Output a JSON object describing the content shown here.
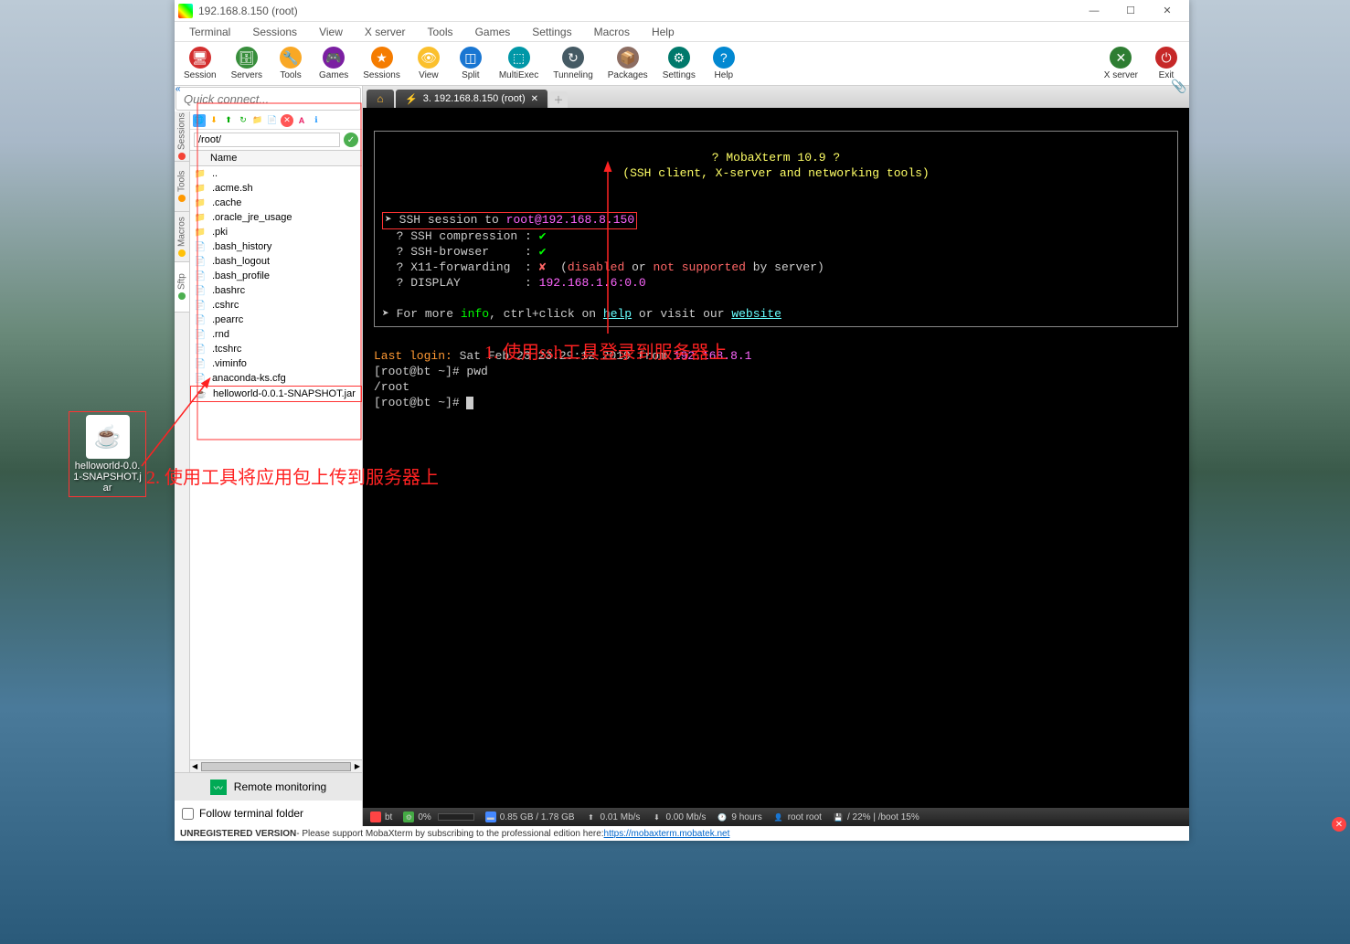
{
  "titlebar": {
    "text": "192.168.8.150 (root)"
  },
  "window_controls": {
    "min": "—",
    "max": "☐",
    "close": "✕"
  },
  "menubar": [
    "Terminal",
    "Sessions",
    "View",
    "X server",
    "Tools",
    "Games",
    "Settings",
    "Macros",
    "Help"
  ],
  "toolbar": [
    {
      "label": "Session",
      "bg": "#d32f2f",
      "glyph": "🖥"
    },
    {
      "label": "Servers",
      "bg": "#388e3c",
      "glyph": "🗄"
    },
    {
      "label": "Tools",
      "bg": "#f9a825",
      "glyph": "🔧"
    },
    {
      "label": "Games",
      "bg": "#7b1fa2",
      "glyph": "🎮"
    },
    {
      "label": "Sessions",
      "bg": "#f57c00",
      "glyph": "★"
    },
    {
      "label": "View",
      "bg": "#fbc02d",
      "glyph": "👁"
    },
    {
      "label": "Split",
      "bg": "#1976d2",
      "glyph": "◫"
    },
    {
      "label": "MultiExec",
      "bg": "#0097a7",
      "glyph": "⬚"
    },
    {
      "label": "Tunneling",
      "bg": "#455a64",
      "glyph": "↻"
    },
    {
      "label": "Packages",
      "bg": "#8d6e63",
      "glyph": "📦"
    },
    {
      "label": "Settings",
      "bg": "#00796b",
      "glyph": "⚙"
    },
    {
      "label": "Help",
      "bg": "#0288d1",
      "glyph": "?"
    }
  ],
  "toolbar_right": [
    {
      "label": "X server",
      "bg": "#2e7d32",
      "glyph": "✕"
    },
    {
      "label": "Exit",
      "bg": "#c62828",
      "glyph": "⏻"
    }
  ],
  "quick_connect": {
    "placeholder": "Quick connect..."
  },
  "side_tabs": [
    {
      "label": "Sessions",
      "color": "#f44336"
    },
    {
      "label": "Tools",
      "color": "#ff9800"
    },
    {
      "label": "Macros",
      "color": "#ffc107"
    },
    {
      "label": "Sftp",
      "color": "#4caf50"
    }
  ],
  "sftp": {
    "path": "/root/",
    "header": "Name",
    "files": [
      {
        "name": "..",
        "type": "folder"
      },
      {
        "name": ".acme.sh",
        "type": "folder"
      },
      {
        "name": ".cache",
        "type": "folder"
      },
      {
        "name": ".oracle_jre_usage",
        "type": "folder"
      },
      {
        "name": ".pki",
        "type": "folder"
      },
      {
        "name": ".bash_history",
        "type": "file"
      },
      {
        "name": ".bash_logout",
        "type": "file"
      },
      {
        "name": ".bash_profile",
        "type": "file"
      },
      {
        "name": ".bashrc",
        "type": "file"
      },
      {
        "name": ".cshrc",
        "type": "file"
      },
      {
        "name": ".pearrc",
        "type": "file"
      },
      {
        "name": ".rnd",
        "type": "file"
      },
      {
        "name": ".tcshrc",
        "type": "file"
      },
      {
        "name": ".viminfo",
        "type": "file"
      },
      {
        "name": "anaconda-ks.cfg",
        "type": "file"
      },
      {
        "name": "helloworld-0.0.1-SNAPSHOT.jar",
        "type": "file",
        "selected": true
      }
    ]
  },
  "remote_monitor_label": "Remote monitoring",
  "follow_terminal_label": "Follow terminal folder",
  "term_tab": {
    "label": "3. 192.168.8.150 (root)"
  },
  "terminal": {
    "banner_title": "? MobaXterm 10.9 ?",
    "banner_sub": "(SSH client, X-server and networking tools)",
    "ssh_line_prefix": "SSH session to ",
    "ssh_user": "root",
    "ssh_at": "@",
    "ssh_host": "192.168.8.150",
    "lines": [
      {
        "label": "? SSH compression :",
        "val": "✔",
        "cls": "term-green"
      },
      {
        "label": "? SSH-browser     :",
        "val": "✔",
        "cls": "term-green"
      }
    ],
    "x11_label": "? X11-forwarding  : ",
    "x11_x": "✘",
    "x11_disabled": "disabled",
    "x11_or": " or ",
    "x11_not": "not supported",
    "x11_by": " by server)",
    "display_label": "? DISPLAY         : ",
    "display_val": "192.168.1.6:0.0",
    "more_prefix": "➤ For more ",
    "more_info": "info",
    "more_mid": ", ctrl+click on ",
    "more_help": "help",
    "more_mid2": " or visit our ",
    "more_website": "website",
    "last_login_label": "Last login:",
    "last_login_val": " Sat Feb 23 23:29:12 2019 from ",
    "last_login_ip": "192.168.8.1",
    "prompt1": "[root@bt ~]# ",
    "cmd1": "pwd",
    "out1": "/root",
    "prompt2": "[root@bt ~]# "
  },
  "statusbar": {
    "bt": "bt",
    "cpu": "0%",
    "mem": "0.85 GB / 1.78 GB",
    "up": "0.01 Mb/s",
    "down": "0.00 Mb/s",
    "uptime": "9 hours",
    "user": "root root",
    "disk": "/ 22%  |  /boot 15%"
  },
  "footer": {
    "unreg": "UNREGISTERED VERSION",
    "text": " - Please support MobaXterm by subscribing to the professional edition here: ",
    "link": "https://mobaxterm.mobatek.net"
  },
  "desktop_icon": {
    "label": "helloworld-0.0.1-SNAPSHOT.jar"
  },
  "annotations": {
    "a1": "1. 使用ssh工具登录到服务器上",
    "a2": "2. 使用工具将应用包上传到服务器上"
  }
}
